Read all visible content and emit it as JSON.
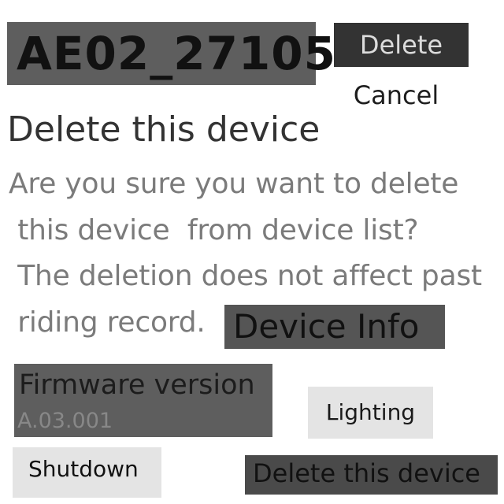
{
  "header": {
    "device_name": "AE02_27105"
  },
  "dialog": {
    "delete_label": "Delete",
    "cancel_label": "Cancel",
    "title": "Delete this device",
    "message": "Are you sure you want to delete\n this device  from device list?\n The deletion does not affect past\n riding record."
  },
  "device_info": {
    "heading": "Device Info",
    "firmware_label": "Firmware version",
    "firmware_value": "A.03.001",
    "lighting_label": "Lighting",
    "shutdown_label": "Shutdown",
    "delete_device_label": "Delete this device"
  },
  "colors": {
    "overlay": "#5e5e5e",
    "dark_button": "#333333",
    "light_button": "#e4e4e4"
  }
}
